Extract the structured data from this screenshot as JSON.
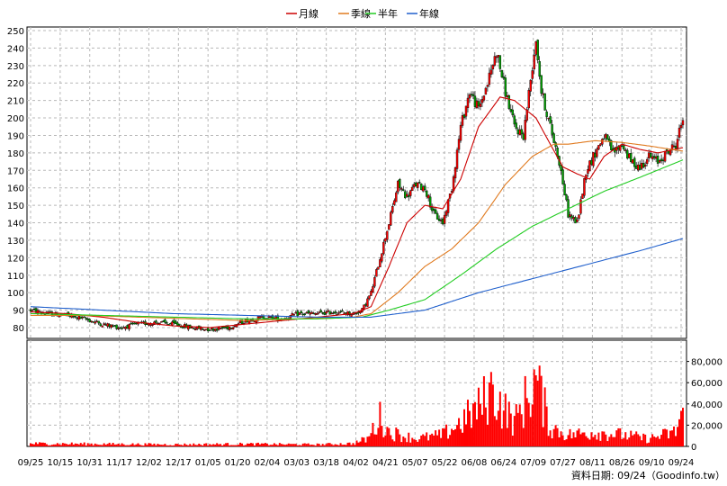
{
  "chart_data": [
    {
      "type": "candlestick",
      "legend": [
        {
          "name": "月線",
          "color": "#cc0000"
        },
        {
          "name": "季線",
          "color": "#e07a1f"
        },
        {
          "name": "半年",
          "color": "#22cc22"
        },
        {
          "name": "年線",
          "color": "#1f5fcc"
        }
      ],
      "ylim": [
        80,
        250
      ],
      "yticks": [
        80,
        90,
        100,
        110,
        120,
        130,
        140,
        150,
        160,
        170,
        180,
        190,
        200,
        210,
        220,
        230,
        240,
        250
      ],
      "xticks": [
        "09/25",
        "10/15",
        "10/31",
        "11/17",
        "12/02",
        "12/17",
        "01/05",
        "01/20",
        "02/04",
        "03/03",
        "03/18",
        "04/02",
        "04/21",
        "05/07",
        "05/22",
        "06/08",
        "06/24",
        "07/09",
        "07/27",
        "08/11",
        "08/26",
        "09/10",
        "09/24"
      ],
      "grid": true,
      "price_anchors": [
        [
          0,
          90
        ],
        [
          10,
          88
        ],
        [
          20,
          87
        ],
        [
          30,
          85
        ],
        [
          40,
          82
        ],
        [
          50,
          80
        ],
        [
          60,
          82
        ],
        [
          70,
          83
        ],
        [
          80,
          82
        ],
        [
          90,
          80
        ],
        [
          100,
          79
        ],
        [
          110,
          80
        ],
        [
          120,
          84
        ],
        [
          130,
          86
        ],
        [
          140,
          85
        ],
        [
          150,
          88
        ],
        [
          160,
          88
        ],
        [
          170,
          89
        ],
        [
          180,
          88
        ],
        [
          185,
          90
        ],
        [
          190,
          100
        ],
        [
          195,
          120
        ],
        [
          200,
          140
        ],
        [
          205,
          162
        ],
        [
          210,
          155
        ],
        [
          215,
          162
        ],
        [
          220,
          160
        ],
        [
          225,
          145
        ],
        [
          230,
          140
        ],
        [
          235,
          160
        ],
        [
          240,
          195
        ],
        [
          245,
          215
        ],
        [
          250,
          205
        ],
        [
          255,
          220
        ],
        [
          260,
          238
        ],
        [
          265,
          215
        ],
        [
          270,
          195
        ],
        [
          275,
          190
        ],
        [
          280,
          230
        ],
        [
          282,
          245
        ],
        [
          285,
          215
        ],
        [
          290,
          195
        ],
        [
          295,
          175
        ],
        [
          300,
          145
        ],
        [
          305,
          140
        ],
        [
          310,
          170
        ],
        [
          315,
          180
        ],
        [
          320,
          190
        ],
        [
          325,
          180
        ],
        [
          330,
          185
        ],
        [
          335,
          175
        ],
        [
          340,
          172
        ],
        [
          345,
          178
        ],
        [
          350,
          175
        ],
        [
          355,
          180
        ],
        [
          360,
          185
        ],
        [
          364,
          200
        ]
      ],
      "moving_averages": {
        "月線": [
          [
            0,
            89
          ],
          [
            20,
            88
          ],
          [
            40,
            86
          ],
          [
            60,
            83
          ],
          [
            80,
            81
          ],
          [
            100,
            80
          ],
          [
            120,
            82
          ],
          [
            140,
            84
          ],
          [
            160,
            86
          ],
          [
            180,
            88
          ],
          [
            190,
            92
          ],
          [
            200,
            115
          ],
          [
            210,
            140
          ],
          [
            220,
            150
          ],
          [
            230,
            148
          ],
          [
            240,
            165
          ],
          [
            250,
            195
          ],
          [
            262,
            212
          ],
          [
            270,
            210
          ],
          [
            282,
            200
          ],
          [
            290,
            185
          ],
          [
            297,
            172
          ],
          [
            305,
            168
          ],
          [
            312,
            165
          ],
          [
            320,
            178
          ],
          [
            330,
            185
          ],
          [
            340,
            182
          ],
          [
            350,
            180
          ],
          [
            364,
            183
          ]
        ],
        "季線": [
          [
            0,
            87
          ],
          [
            30,
            87
          ],
          [
            60,
            86
          ],
          [
            90,
            85
          ],
          [
            120,
            84
          ],
          [
            150,
            85
          ],
          [
            180,
            86
          ],
          [
            190,
            88
          ],
          [
            205,
            100
          ],
          [
            220,
            115
          ],
          [
            235,
            125
          ],
          [
            250,
            140
          ],
          [
            265,
            162
          ],
          [
            280,
            178
          ],
          [
            292,
            185
          ],
          [
            300,
            185
          ],
          [
            315,
            187
          ],
          [
            330,
            186
          ],
          [
            345,
            184
          ],
          [
            364,
            181
          ]
        ],
        "半年": [
          [
            0,
            88
          ],
          [
            40,
            87
          ],
          [
            80,
            86
          ],
          [
            120,
            85
          ],
          [
            160,
            85
          ],
          [
            185,
            86
          ],
          [
            200,
            90
          ],
          [
            220,
            96
          ],
          [
            240,
            110
          ],
          [
            260,
            125
          ],
          [
            280,
            138
          ],
          [
            300,
            148
          ],
          [
            320,
            158
          ],
          [
            340,
            166
          ],
          [
            364,
            176
          ]
        ],
        "年線": [
          [
            0,
            92
          ],
          [
            40,
            90
          ],
          [
            80,
            88
          ],
          [
            120,
            87
          ],
          [
            160,
            86
          ],
          [
            190,
            86
          ],
          [
            220,
            90
          ],
          [
            250,
            100
          ],
          [
            280,
            108
          ],
          [
            310,
            116
          ],
          [
            340,
            124
          ],
          [
            364,
            131
          ]
        ]
      }
    },
    {
      "type": "bar",
      "ylim": [
        0,
        100000
      ],
      "yticks": [
        0,
        20000,
        40000,
        60000,
        80000
      ],
      "ytick_labels": [
        "0",
        "20,000",
        "40,000",
        "60,000",
        "80,000"
      ],
      "color": "#ff0000",
      "volume_anchors": [
        [
          0,
          3000
        ],
        [
          40,
          2500
        ],
        [
          80,
          2000
        ],
        [
          120,
          2500
        ],
        [
          160,
          2000
        ],
        [
          180,
          3000
        ],
        [
          188,
          8000
        ],
        [
          195,
          30000
        ],
        [
          200,
          15000
        ],
        [
          215,
          8000
        ],
        [
          230,
          12000
        ],
        [
          240,
          25000
        ],
        [
          250,
          40000
        ],
        [
          258,
          60000
        ],
        [
          262,
          45000
        ],
        [
          270,
          25000
        ],
        [
          278,
          55000
        ],
        [
          282,
          70000
        ],
        [
          290,
          20000
        ],
        [
          300,
          12000
        ],
        [
          315,
          15000
        ],
        [
          330,
          12000
        ],
        [
          345,
          8000
        ],
        [
          360,
          15000
        ],
        [
          364,
          40000
        ]
      ]
    }
  ],
  "footer": "資料日期: 09/24（Goodinfo.tw）"
}
